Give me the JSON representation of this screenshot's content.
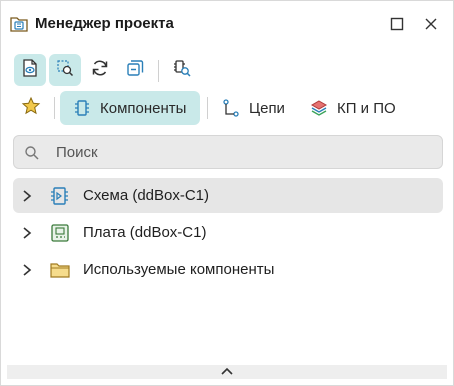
{
  "window": {
    "title": "Менеджер проекта",
    "title_icon": "project-manager-icon",
    "maximize_icon": "maximize-icon",
    "close_icon": "close-icon"
  },
  "toolbar": {
    "buttons": [
      {
        "name": "show-document-button",
        "icon": "document-eye-icon",
        "active": true
      },
      {
        "name": "find-in-document-button",
        "icon": "document-search-icon",
        "active": true
      },
      {
        "name": "refresh-button",
        "icon": "refresh-icon",
        "active": false
      },
      {
        "name": "collapse-all-button",
        "icon": "collapse-icon",
        "active": false
      },
      {
        "name": "component-search-button",
        "icon": "component-search-icon",
        "active": false
      }
    ]
  },
  "tabs": {
    "favorites_icon": "star-icon",
    "items": [
      {
        "label": "Компоненты",
        "icon": "component-icon",
        "active": true
      },
      {
        "label": "Цепи",
        "icon": "net-icon",
        "active": false
      },
      {
        "label": "КП и ПО",
        "icon": "layers-icon",
        "active": false
      }
    ]
  },
  "search": {
    "placeholder": "Поиск",
    "value": "",
    "icon": "search-icon"
  },
  "tree": {
    "items": [
      {
        "label": "Схема (ddBox-C1)",
        "icon": "schematic-icon",
        "expanded": false,
        "selected": true
      },
      {
        "label": "Плата (ddBox-C1)",
        "icon": "board-icon",
        "expanded": false,
        "selected": false
      },
      {
        "label": "Используемые компоненты",
        "icon": "folder-icon",
        "expanded": false,
        "selected": false
      }
    ]
  },
  "footer": {
    "collapse_icon": "chevron-up-icon"
  },
  "colors": {
    "active_bg": "#c9e9e9",
    "accent": "#2a7fb8",
    "selected_row": "#e6e6e6",
    "search_bg": "#eaeaea"
  }
}
